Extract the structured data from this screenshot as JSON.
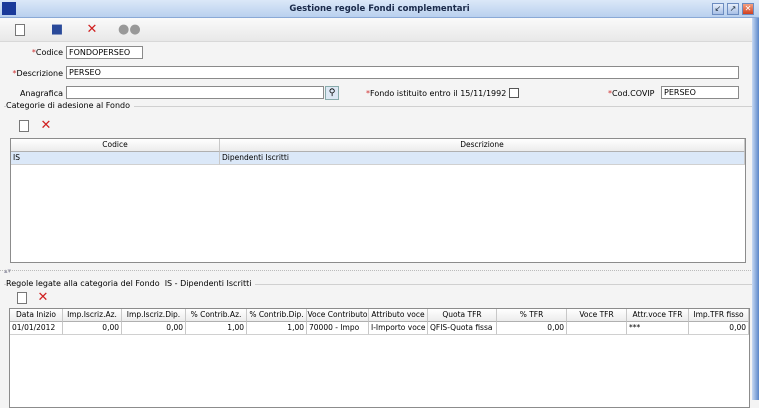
{
  "window": {
    "title": "Gestione regole Fondi complementari"
  },
  "toolbar": {
    "icons": [
      "new-icon",
      "save-icon",
      "delete-icon",
      "binoculars-icon"
    ]
  },
  "form": {
    "codice_label": "Codice",
    "codice_value": "FONDOPERSEO",
    "descrizione_label": "Descrizione",
    "descrizione_value": "PERSEO",
    "anagrafica_label": "Anagrafica",
    "anagrafica_value": "",
    "fondo_istituito_label": "Fondo istituito entro il 15/11/1992",
    "fondo_istituito_checked": false,
    "covip_label": "Cod.COVIP",
    "covip_value": "PERSEO",
    "required_mark": "*"
  },
  "categorie": {
    "title": "Categorie di adesione al Fondo",
    "columns": [
      "Codice",
      "Descrizione"
    ],
    "rows": [
      [
        "IS",
        "Dipendenti Iscritti"
      ]
    ]
  },
  "regole": {
    "title": "Regole legate alla categoria del Fondo  IS - Dipendenti Iscritti",
    "columns": [
      "Data Inizio",
      "Imp.Iscriz.Az.",
      "Imp.Iscriz.Dip.",
      "% Contrib.Az.",
      "% Contrib.Dip.",
      "Voce Contributo",
      "Attributo voce",
      "Quota TFR",
      "% TFR",
      "Voce TFR",
      "Attr.voce TFR",
      "Imp.TFR fisso"
    ],
    "rows": [
      [
        "01/01/2012",
        "0,00",
        "0,00",
        "1,00",
        "1,00",
        "70000  -  Impo",
        "I-Importo voce",
        "QFIS-Quota fissa",
        "0,00",
        "",
        "***",
        "0,00"
      ]
    ]
  }
}
